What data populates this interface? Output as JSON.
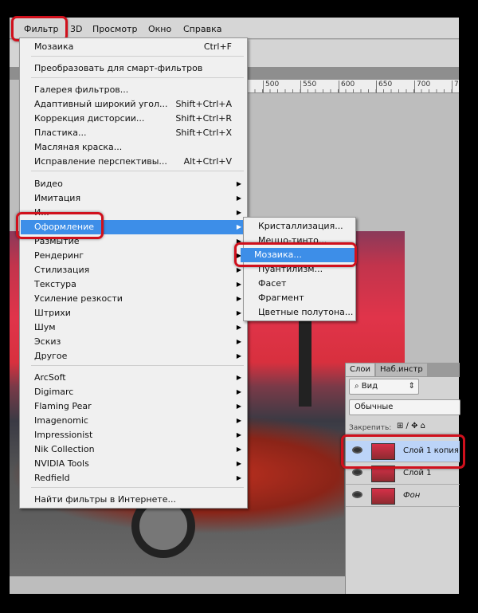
{
  "menubar": {
    "items": [
      "Фильтр",
      "3D",
      "Просмотр",
      "Окно",
      "Справка"
    ]
  },
  "ruler": {
    "ticks": [
      "500",
      "550",
      "600",
      "650",
      "700",
      "7"
    ]
  },
  "filter_menu": {
    "items": [
      {
        "label": "Мозаика",
        "shortcut": "Ctrl+F"
      },
      {
        "label": "Преобразовать для смарт-фильтров"
      },
      {
        "label": "Галерея фильтров..."
      },
      {
        "label": "Адаптивный широкий угол...",
        "shortcut": "Shift+Ctrl+A"
      },
      {
        "label": "Коррекция дисторсии...",
        "shortcut": "Shift+Ctrl+R"
      },
      {
        "label": "Пластика...",
        "shortcut": "Shift+Ctrl+X"
      },
      {
        "label": "Масляная краска..."
      },
      {
        "label": "Исправление перспективы...",
        "shortcut": "Alt+Ctrl+V"
      },
      {
        "label": "Видео",
        "submenu": true
      },
      {
        "label": "Имитация",
        "submenu": true
      },
      {
        "label": "И...",
        "submenu": true
      },
      {
        "label": "Оформление",
        "submenu": true,
        "highlighted": true
      },
      {
        "label": "Размытие",
        "submenu": true
      },
      {
        "label": "Рендеринг",
        "submenu": true
      },
      {
        "label": "Стилизация",
        "submenu": true
      },
      {
        "label": "Текстура",
        "submenu": true
      },
      {
        "label": "Усиление резкости",
        "submenu": true
      },
      {
        "label": "Штрихи",
        "submenu": true
      },
      {
        "label": "Шум",
        "submenu": true
      },
      {
        "label": "Эскиз",
        "submenu": true
      },
      {
        "label": "Другое",
        "submenu": true
      },
      {
        "label": "ArcSoft",
        "submenu": true
      },
      {
        "label": "Digimarc",
        "submenu": true
      },
      {
        "label": "Flaming Pear",
        "submenu": true
      },
      {
        "label": "Imagenomic",
        "submenu": true
      },
      {
        "label": "Impressionist",
        "submenu": true
      },
      {
        "label": "Nik Collection",
        "submenu": true
      },
      {
        "label": "NVIDIA Tools",
        "submenu": true
      },
      {
        "label": "Redfield",
        "submenu": true
      },
      {
        "label": "Найти фильтры в Интернете..."
      }
    ]
  },
  "submenu": {
    "items": [
      {
        "label": "Кристаллизация..."
      },
      {
        "label": "Меццо-тинто..."
      },
      {
        "label": "Мозаика...",
        "highlighted": true
      },
      {
        "label": "Пуантилизм..."
      },
      {
        "label": "Фасет"
      },
      {
        "label": "Фрагмент"
      },
      {
        "label": "Цветные полутона..."
      }
    ]
  },
  "layers_panel": {
    "tabs": [
      "Слои",
      "Наб.инстр"
    ],
    "filter": "Вид",
    "blend_mode": "Обычные",
    "lock_label": "Закрепить:",
    "layers": [
      {
        "name": "Слой 1 копия",
        "selected": true
      },
      {
        "name": "Слой 1"
      },
      {
        "name": "Фон"
      }
    ]
  },
  "colors": {
    "highlight": "#3d8ee8",
    "annotation": "#d0101c",
    "selected_layer": "#bcd4f8"
  }
}
